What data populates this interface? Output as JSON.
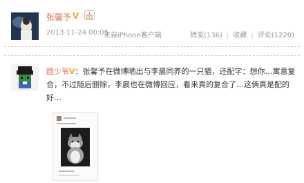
{
  "post1": {
    "username": "张馨予",
    "verified_badge": "V",
    "birthday_icon": "cake-icon",
    "timestamp": "2013-11-24 00:05",
    "source": "来自iPhone客户端",
    "actions": {
      "repost": "转发(136)",
      "favorite": "收藏",
      "comment": "评论(1220)"
    }
  },
  "post2": {
    "username": "圆少爷",
    "verified_badge": "V",
    "text": "：张馨予在微博晒出与李晨同养的一只猫，还配字：想你…寓意复合，不过随后删除，李晨也在微博回应，看来真的复合了…这俩真是配的好…"
  },
  "colors": {
    "username": "#eb7350",
    "badge": "#f6a623",
    "meta": "#999999",
    "divider": "#cfcfcf"
  }
}
